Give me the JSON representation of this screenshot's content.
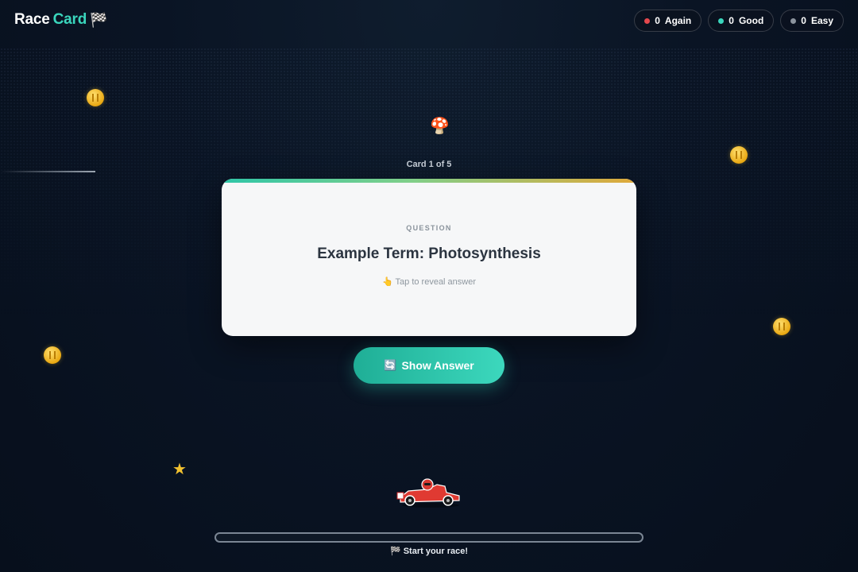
{
  "app": {
    "logo_race": "Race",
    "logo_card": "Card",
    "logo_icon": "checkered-flag-icon"
  },
  "stats": {
    "again": {
      "count": "0",
      "label": "Again",
      "color": "#e5484d"
    },
    "good": {
      "count": "0",
      "label": "Good",
      "color": "#3ad6bd"
    },
    "easy": {
      "count": "0",
      "label": "Easy",
      "color": "#8b939d"
    }
  },
  "card": {
    "counter": "Card 1 of 5",
    "label": "QUESTION",
    "term": "Example Term: Photosynthesis",
    "hint": "👆 Tap to reveal answer"
  },
  "actions": {
    "show_answer_icon": "🔄",
    "show_answer_label": "Show Answer"
  },
  "progress": {
    "value": 0,
    "label": "🏁 Start your race!"
  },
  "decorations": [
    "coin-icon",
    "mushroom-icon",
    "star-icon",
    "race-kart-icon"
  ],
  "colors": {
    "accent": "#3ad6bd",
    "background": "#0a1424",
    "card": "#f6f7f8"
  }
}
